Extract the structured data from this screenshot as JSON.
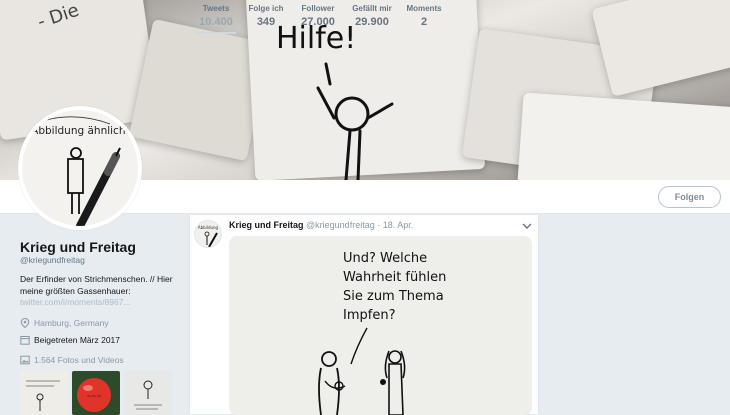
{
  "banner": {
    "text_hilfe": "Hilfe!",
    "text_die": "- Die"
  },
  "profile_nav": {
    "stats": [
      {
        "label": "Tweets",
        "value": "10.400",
        "active": true
      },
      {
        "label": "Folge ich",
        "value": "349"
      },
      {
        "label": "Follower",
        "value": "27.000"
      },
      {
        "label": "Gefällt mir",
        "value": "29.900"
      },
      {
        "label": "Moments",
        "value": "2"
      }
    ],
    "follow_label": "Folgen"
  },
  "avatar": {
    "text": "Abbildung ähnlich."
  },
  "profile": {
    "name": "Krieg und Freitag",
    "handle": "@kriegundfreitag",
    "bio": "Der Erfinder von Strichmenschen. // Hier meine größten Gassenhauer:",
    "link": "twitter.com/i/moments/8967...",
    "location": "Hamburg, Germany",
    "joined": "Beigetreten März 2017",
    "media": "1.564 Fotos und Videos"
  },
  "tweet": {
    "name": "Krieg und Freitag",
    "handle": "@kriegundfreitag",
    "date": "· 18. Apr.",
    "image_text": [
      "Und? Welche",
      "Wahrheit fühlen",
      "Sie zum Thema",
      "Impfen?"
    ]
  },
  "colors": {
    "accent": "#1da1f2",
    "muted": "#657786",
    "bg": "#e6ecf0"
  }
}
